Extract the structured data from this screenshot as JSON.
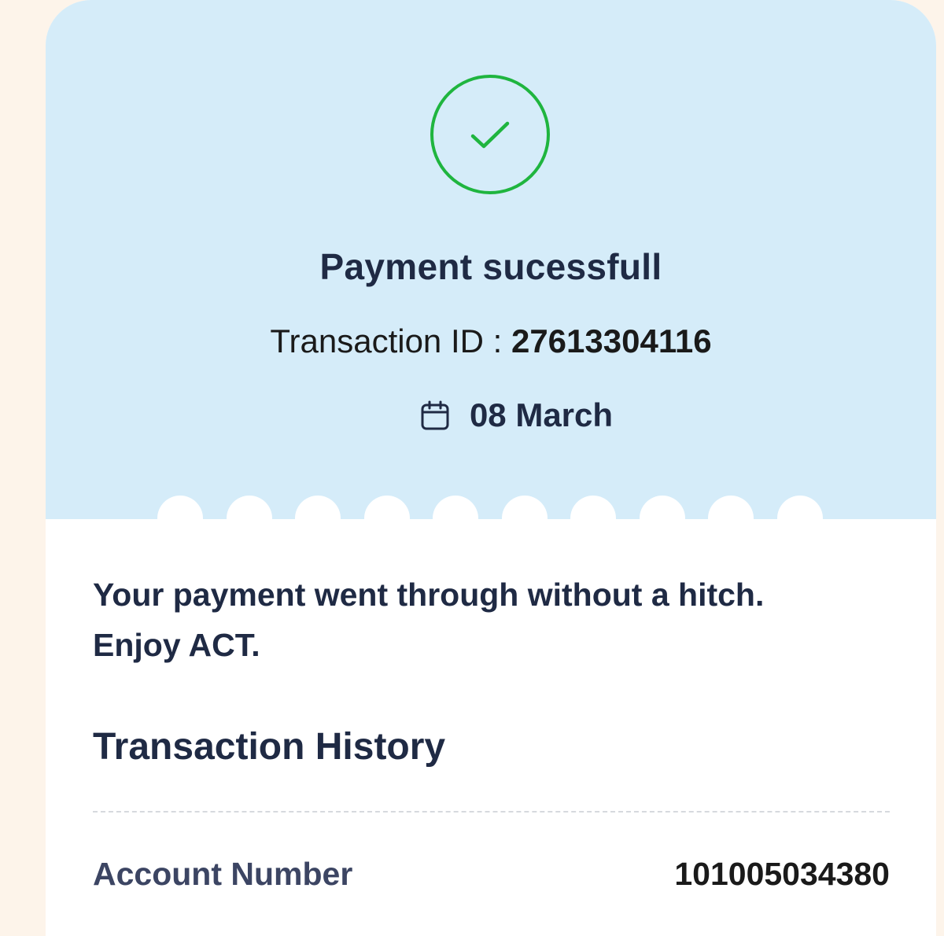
{
  "header": {
    "status_title": "Payment sucessfull",
    "transaction_label": "Transaction ID : ",
    "transaction_id": "27613304116",
    "date": "08 March"
  },
  "body": {
    "message_line1": "Your payment went through without a hitch.",
    "message_line2": "Enjoy ACT.",
    "section_title": "Transaction History",
    "rows": [
      {
        "label": "Account Number",
        "value": "101005034380"
      }
    ]
  },
  "colors": {
    "success": "#1fb53f",
    "header_bg": "#d5ecf9",
    "page_bg": "#fdf4ea",
    "text_dark": "#1f2a44"
  },
  "icons": [
    "check-icon",
    "calendar-icon"
  ]
}
